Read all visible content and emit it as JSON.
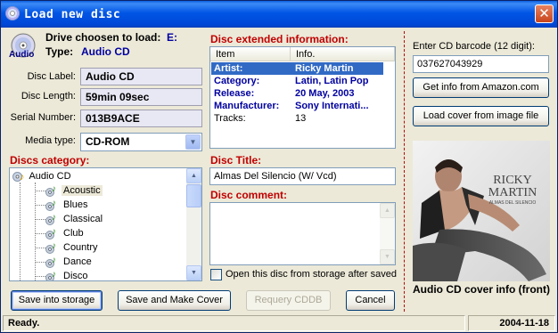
{
  "window": {
    "title": "Load new disc",
    "close_symbol": "✕"
  },
  "drive": {
    "label": "Drive choosen to load:",
    "value": "E:",
    "type_label": "Type:",
    "type_value": "Audio CD",
    "icon_text": "Audio"
  },
  "fields": {
    "disc_label_label": "Disc Label:",
    "disc_label_value": "Audio CD",
    "disc_length_label": "Disc Length:",
    "disc_length_value": "59min 09sec",
    "serial_label": "Serial Number:",
    "serial_value": "013B9ACE",
    "media_type_label": "Media type:",
    "media_type_value": "CD-ROM"
  },
  "categories": {
    "header": "Discs category:",
    "root": "Audio CD",
    "items": [
      "Acoustic",
      "Blues",
      "Classical",
      "Club",
      "Country",
      "Dance",
      "Disco"
    ],
    "selected": "Acoustic"
  },
  "extended": {
    "header": "Disc extended information:",
    "col_item": "Item",
    "col_info": "Info.",
    "rows": [
      {
        "item": "Artist:",
        "info": "Ricky Martin",
        "selected": true,
        "bold": true
      },
      {
        "item": "Category:",
        "info": "Latin, Latin Pop",
        "selected": false,
        "bold": true
      },
      {
        "item": "Release:",
        "info": "20 May, 2003",
        "selected": false,
        "bold": true
      },
      {
        "item": "Manufacturer:",
        "info": "Sony Internati...",
        "selected": false,
        "bold": true
      },
      {
        "item": "Tracks:",
        "info": "13",
        "selected": false,
        "bold": false
      }
    ]
  },
  "disc_title": {
    "header": "Disc Title:",
    "value": "Almas Del Silencio (W/ Vcd)"
  },
  "disc_comment": {
    "header": "Disc comment:",
    "value": ""
  },
  "open_storage": {
    "label": "Open this disc from storage after saved",
    "checked": false
  },
  "barcode": {
    "label": "Enter CD barcode (12 digit):",
    "value": "037627043929",
    "amazon_button": "Get info from Amazon.com",
    "load_cover_button": "Load cover from image file"
  },
  "cover": {
    "caption": "Audio CD cover info (front)",
    "art_line1": "RICKY",
    "art_line2": "MARTIN",
    "art_line3": "ALMAS DEL SILENCIO"
  },
  "buttons": {
    "save_storage": "Save into storage",
    "save_make_cover": "Save and Make Cover",
    "requery": "Requery CDDB",
    "cancel": "Cancel"
  },
  "status": {
    "text": "Ready.",
    "date": "2004-11-18"
  },
  "colors": {
    "accent_red": "#C00000",
    "label_blue": "#0000A0",
    "selection": "#316AC5"
  }
}
